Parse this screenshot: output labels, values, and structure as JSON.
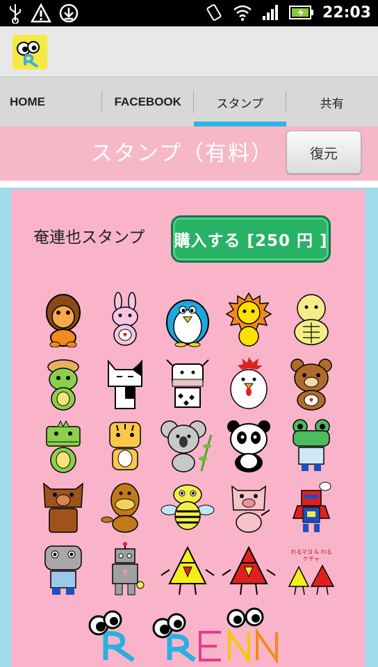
{
  "status_bar": {
    "time": "22:03",
    "left_icons": [
      "usb-icon",
      "warning-icon",
      "download-icon"
    ],
    "right_icons": [
      "vibrate-icon",
      "wifi-icon",
      "signal-icon",
      "battery-icon"
    ]
  },
  "action_bar": {
    "logo_icon": "app-logo-icon"
  },
  "tabs": [
    {
      "label": "HOME",
      "selected": false
    },
    {
      "label": "FACEBOOK",
      "selected": false
    },
    {
      "label": "スタンプ",
      "selected": true
    },
    {
      "label": "共有",
      "selected": false
    }
  ],
  "header": {
    "title": "スタンプ（有料）",
    "restore_label": "復元"
  },
  "stamp_pack": {
    "name": "奄連也スタンプ",
    "buy_label": "購入する [250 円 ]"
  },
  "stamps": [
    "monkey",
    "rabbit",
    "penguin",
    "lion",
    "turtle",
    "kappa",
    "cat",
    "cow",
    "rooster",
    "bear",
    "dinosaur",
    "tiger",
    "koala",
    "panda",
    "frog",
    "boar",
    "platypus",
    "bee",
    "pig",
    "robot-hero",
    "hippo-robot",
    "tin-robot",
    "yellow-triangle-character",
    "red-triangle-character",
    "triangle-duo"
  ],
  "stamp_caption": "わるマヨ & わるケチャ",
  "footer_logo": "RENN",
  "colors": {
    "tab_indicator": "#2cb4e2",
    "header_pink": "#f6b8c9",
    "card_pink": "#f9b4c9",
    "buy_green": "#27b265",
    "frame_blue": "#9fdcec"
  }
}
